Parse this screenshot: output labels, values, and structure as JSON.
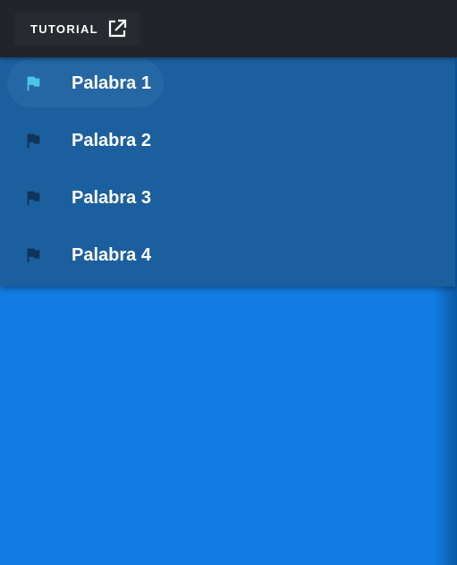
{
  "header": {
    "tutorial_label": "TUTORIAL",
    "tutorial_icon": "open-in-new-icon"
  },
  "word_list": {
    "items": [
      {
        "label": "Palabra 1",
        "icon": "flag-icon",
        "active": true
      },
      {
        "label": "Palabra 2",
        "icon": "flag-icon",
        "active": false
      },
      {
        "label": "Palabra 3",
        "icon": "flag-icon",
        "active": false
      },
      {
        "label": "Palabra 4",
        "icon": "flag-icon",
        "active": false
      }
    ]
  },
  "colors": {
    "topbar": "#212529",
    "panel": "#1c5f9e",
    "background": "#117ce3",
    "active_flag": "#4fc3e8",
    "inactive_flag": "#10335a",
    "text": "#ffffff"
  }
}
